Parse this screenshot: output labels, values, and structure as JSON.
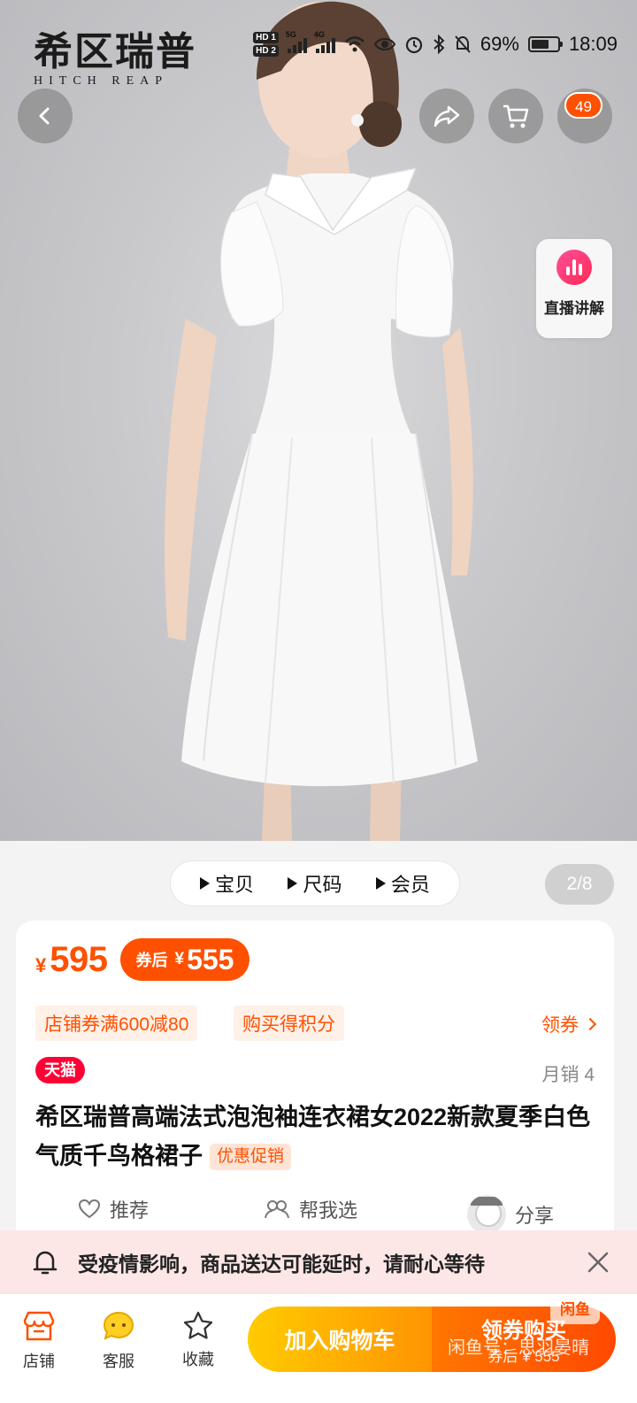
{
  "brand": {
    "cn": "希区瑞普",
    "en": "HITCH REAP"
  },
  "status_bar": {
    "hd1": "HD 1",
    "hd2": "HD 2",
    "net1": "5G",
    "net2": "4G",
    "battery_percent": "69%",
    "battery_level": 0.69,
    "time": "18:09"
  },
  "nav": {
    "cart_badge": "49"
  },
  "live": {
    "label": "直播讲解"
  },
  "gallery": {
    "tabs": [
      "宝贝",
      "尺码",
      "会员"
    ],
    "page_indicator": "2/8"
  },
  "product": {
    "currency": "¥",
    "price": "595",
    "coupon_label": "券后",
    "coupon_currency": "¥",
    "coupon_price": "555",
    "promo_tags": [
      "店铺券满600减80",
      "购买得积分"
    ],
    "get_coupon": "领券",
    "platform_badge": "天猫",
    "monthly_sales": "月销 4",
    "title": "希区瑞普高端法式泡泡袖连衣裙女2022新款夏季白色气质千鸟格裙子",
    "title_tag": "优惠促销",
    "actions": [
      "推荐",
      "帮我选",
      "分享"
    ]
  },
  "notice": {
    "text": "受疫情影响，商品送达可能延时，请耐心等待"
  },
  "bottom_bar": {
    "shop": "店铺",
    "service": "客服",
    "favorite": "收藏",
    "add_cart": "加入购物车",
    "buy_title": "领券购买",
    "buy_sub": "券后 ¥ 555",
    "watermark": "闲鱼号：思羽晏晴",
    "watermark_logo": "闲鱼"
  },
  "colors": {
    "accent": "#ff5000",
    "tmall": "#ff0036",
    "cart_btn": "#ffb000",
    "notice_bg": "#fce7e6"
  }
}
